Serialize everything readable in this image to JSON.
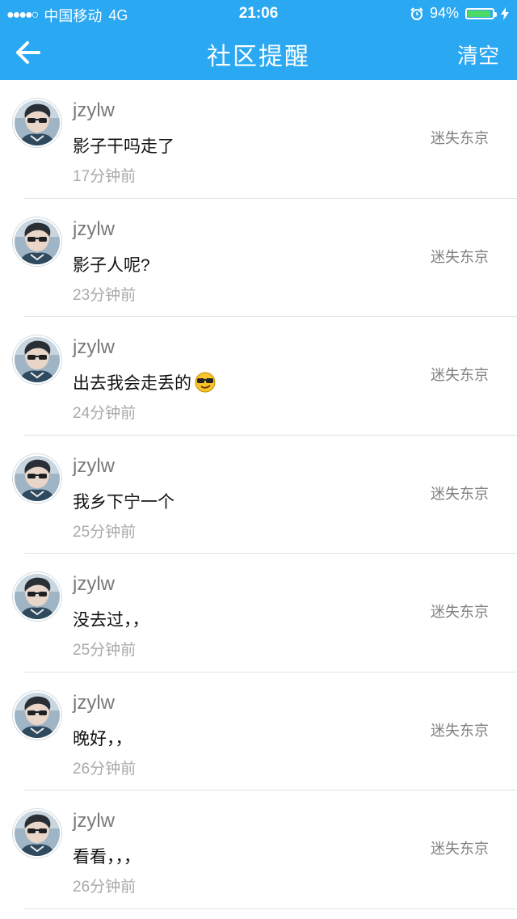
{
  "status_bar": {
    "signal_dots": "●●●●○",
    "carrier": "中国移动",
    "network": "4G",
    "time": "21:06",
    "battery_percent": "94%",
    "battery_level": 0.94
  },
  "navbar": {
    "title": "社区提醒",
    "clear_label": "清空"
  },
  "notifications": [
    {
      "username": "jzylw",
      "content": "影子干吗走了",
      "time": "17分钟前",
      "source": "迷失东京"
    },
    {
      "username": "jzylw",
      "content": "影子人呢?",
      "time": "23分钟前",
      "source": "迷失东京"
    },
    {
      "username": "jzylw",
      "content": "出去我会走丢的",
      "time": "24分钟前",
      "source": "迷失东京",
      "emoji": "cool-face-emoji"
    },
    {
      "username": "jzylw",
      "content": "我乡下宁一个",
      "time": "25分钟前",
      "source": "迷失东京"
    },
    {
      "username": "jzylw",
      "content": "没去过，，",
      "time": "25分钟前",
      "source": "迷失东京"
    },
    {
      "username": "jzylw",
      "content": "晚好，，",
      "time": "26分钟前",
      "source": "迷失东京"
    },
    {
      "username": "jzylw",
      "content": "看看，，，",
      "time": "26分钟前",
      "source": "迷失东京"
    }
  ],
  "colors": {
    "header": "#2aa8f2",
    "battery_fill": "#4cd964"
  }
}
